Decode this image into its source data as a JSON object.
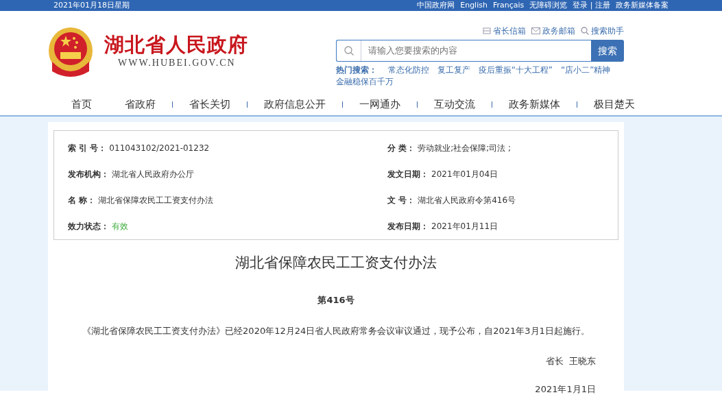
{
  "top_bar": {
    "date": "2021年01月18日星期",
    "links": [
      "中国政府网",
      "English",
      "Français",
      "无障碍浏览",
      "登录 | 注册",
      "政务新媒体备案"
    ]
  },
  "header": {
    "site_name": "湖北省人民政府",
    "site_url": "WWW.HUBEI.GOV.CN",
    "quick_links": [
      {
        "kind": "mailbox",
        "label": "省长信箱"
      },
      {
        "kind": "mail",
        "label": "政务邮箱"
      },
      {
        "kind": "search",
        "label": "搜索助手"
      }
    ],
    "search": {
      "placeholder": "请输入您要搜索的内容",
      "button": "搜索"
    },
    "hot_search": {
      "label": "热门搜索：",
      "items": [
        "常态化防控",
        "复工复产",
        "疫后重振“十大工程”",
        "“店小二”精神",
        "金融稳保百千万"
      ]
    }
  },
  "nav": [
    "首页",
    "省政府",
    "省长关切",
    "政府信息公开",
    "一网通办",
    "互动交流",
    "政务新媒体",
    "极目楚天"
  ],
  "info": [
    {
      "label": "索 引 号：",
      "value": "011043102/2021-01232",
      "kind": "text"
    },
    {
      "label": "分 类：",
      "value": "劳动就业;社会保障;司法 ;",
      "kind": "text"
    },
    {
      "label": "发布机构：",
      "value": "湖北省人民政府办公厅",
      "kind": "text"
    },
    {
      "label": "发文日期：",
      "value": "2021年01月04日",
      "kind": "text"
    },
    {
      "label": "名 称：",
      "value": "湖北省保障农民工工资支付办法",
      "kind": "text"
    },
    {
      "label": "文 号：",
      "value": "湖北省人民政府令第416号",
      "kind": "text"
    },
    {
      "label": "效力状态：",
      "value": "有效",
      "kind": "status"
    },
    {
      "label": "发布日期：",
      "value": "2021年01月11日",
      "kind": "text"
    }
  ],
  "article": {
    "title": "湖北省保障农民工工资支付办法",
    "number": "第416号",
    "body": "《湖北省保障农民工工资支付办法》已经2020年12月24日省人民政府常务会议审议通过，现予公布，自2021年3月1日起施行。",
    "signature": "省长  王晓东",
    "date": "2021年1月1日"
  }
}
